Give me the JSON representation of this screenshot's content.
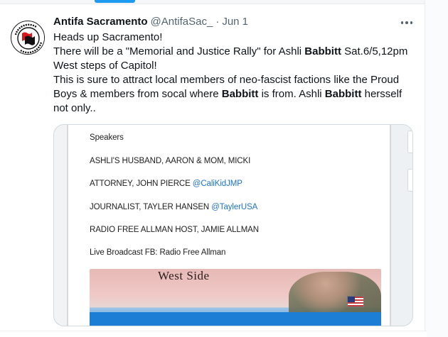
{
  "tweet": {
    "display_name": "Antifa Sacramento",
    "handle": "@AntifaSac_",
    "separator": "·",
    "timestamp": "Jun 1",
    "body": {
      "line1": "Heads up Sacramento!",
      "line2_pre": "There will be a \"Memorial and Justice Rally\" for Ashli ",
      "highlight": "Babbitt",
      "line2_post": " Sat.6/5,12pm",
      "line3": "West steps of Capitol!",
      "line4_pre": "This is sure to attract local members of neo-fascist factions like the Proud Boys & members from socal where ",
      "line4_mid": " is from. Ashli ",
      "line4_post": " hersself not only.."
    }
  },
  "attached_image": {
    "heading": "Speakers",
    "line1": "ASHLI'S HUSBAND, AARON & MOM, MICKI",
    "line2_text": "ATTORNEY, JOHN PIERCE ",
    "line2_mention": "@CaliKidJMP",
    "line3_text": "JOURNALIST, TAYLER HANSEN ",
    "line3_mention": "@TaylerUSA",
    "line4": "RADIO FREE ALLMAN HOST, JAMIE ALLMAN",
    "line5": "Live Broadcast FB: Radio Free Allman",
    "photo_caption": "West Side"
  },
  "colors": {
    "accent": "#1d9bf0",
    "mention": "#1d72c9",
    "text_secondary": "#536471",
    "banner": "#1d7ed6"
  },
  "icons": {
    "avatar": "antifa-flag-logo",
    "more": "more-horizontal-icon"
  }
}
